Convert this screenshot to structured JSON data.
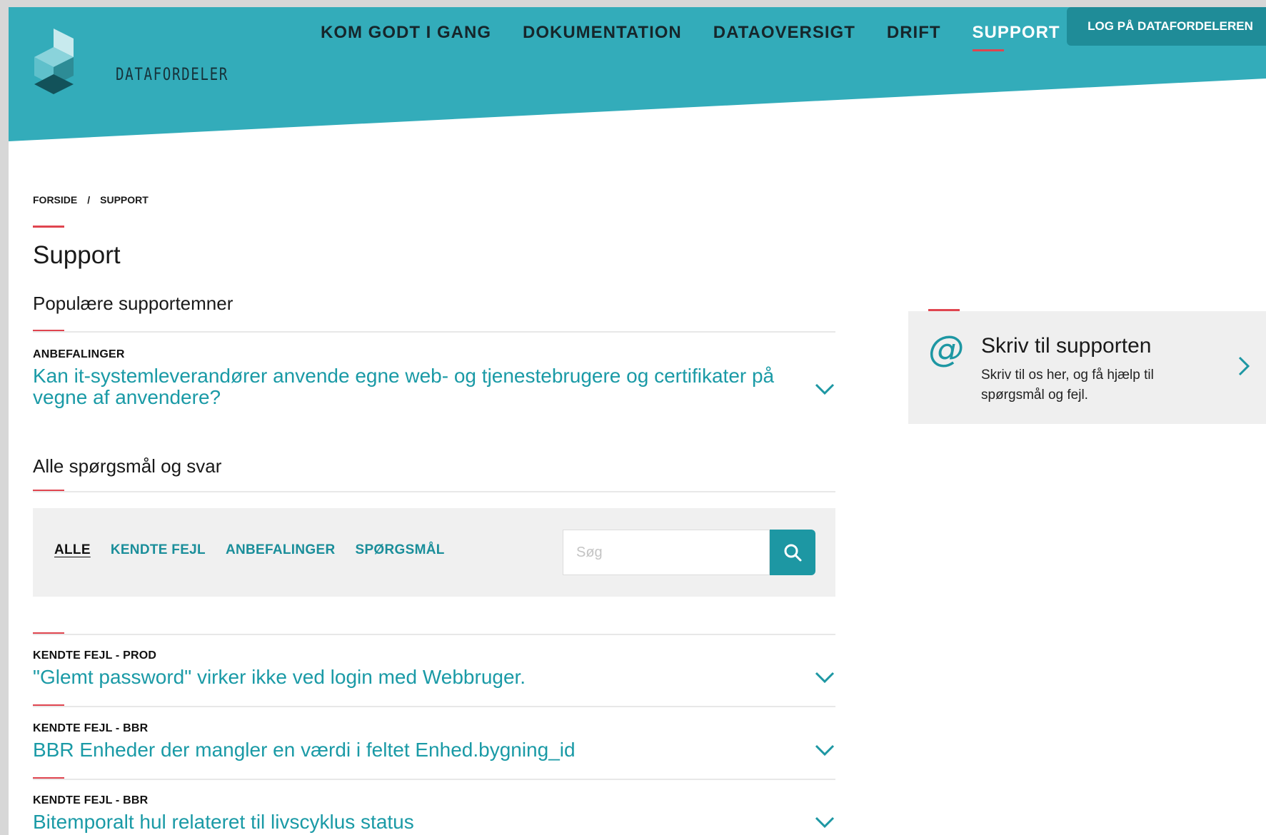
{
  "brand": {
    "name": "DATAFORDELER"
  },
  "nav": {
    "items": [
      {
        "label": "KOM GODT I GANG",
        "active": false
      },
      {
        "label": "DOKUMENTATION",
        "active": false
      },
      {
        "label": "DATAOVERSIGT",
        "active": false
      },
      {
        "label": "DRIFT",
        "active": false
      },
      {
        "label": "SUPPORT",
        "active": true
      }
    ],
    "login_label": "LOG PÅ DATAFORDELEREN"
  },
  "breadcrumb": {
    "home": "FORSIDE",
    "separator": "/",
    "current": "SUPPORT"
  },
  "page": {
    "title": "Support"
  },
  "popular": {
    "title": "Populære supportemner",
    "items": [
      {
        "category": "ANBEFALINGER",
        "question": "Kan it-systemleverandører anvende egne web- og tjenestebrugere og certifikater på vegne af anvendere?"
      }
    ]
  },
  "all": {
    "title": "Alle spørgsmål og svar",
    "filters": [
      {
        "label": "ALLE",
        "active": true
      },
      {
        "label": "KENDTE FEJL",
        "active": false
      },
      {
        "label": "ANBEFALINGER",
        "active": false
      },
      {
        "label": "SPØRGSMÅL",
        "active": false
      }
    ],
    "search_placeholder": "Søg",
    "items": [
      {
        "category": "KENDTE FEJL - PROD",
        "question": "\"Glemt password\" virker ikke ved login med Webbruger."
      },
      {
        "category": "KENDTE FEJL - BBR",
        "question": "BBR Enheder der mangler en værdi i feltet Enhed.bygning_id"
      },
      {
        "category": "KENDTE FEJL - BBR",
        "question": "Bitemporalt hul relateret til livscyklus status"
      }
    ]
  },
  "support_card": {
    "icon": "at-icon",
    "symbol": "@",
    "title": "Skriv til supporten",
    "text": "Skriv til os her, og få hjælp til spørgsmål og fejl."
  },
  "colors": {
    "teal": "#33acba",
    "accent": "#1d97a3",
    "red": "#e0454f"
  }
}
